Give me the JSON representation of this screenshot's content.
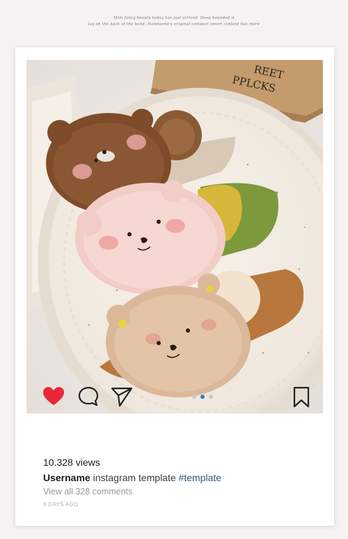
{
  "caption": {
    "line1": "Mini fancy beauty today has just arrived. Deep bounded it",
    "line2": "lay on the back of the band. Handsome's original compact smart content has more"
  },
  "photo": {
    "box_text_line1": "REET",
    "box_text_line2": "PPLCKS"
  },
  "actions": {
    "heart_icon": "heart-filled",
    "comment_icon": "speech-bubble",
    "share_icon": "paper-plane",
    "bookmark_icon": "bookmark",
    "carousel": {
      "count": 3,
      "active": 2
    },
    "like_color": "#e8283a",
    "dot_active_color": "#2f7dc1",
    "dot_inactive_color": "#c8c8c8"
  },
  "post": {
    "views": "10.328 views",
    "username": "Username",
    "text": "instagram template",
    "hashtag": "#template",
    "comments_link": "View all 328 comments",
    "time_ago": "6 DAYS AGO"
  }
}
